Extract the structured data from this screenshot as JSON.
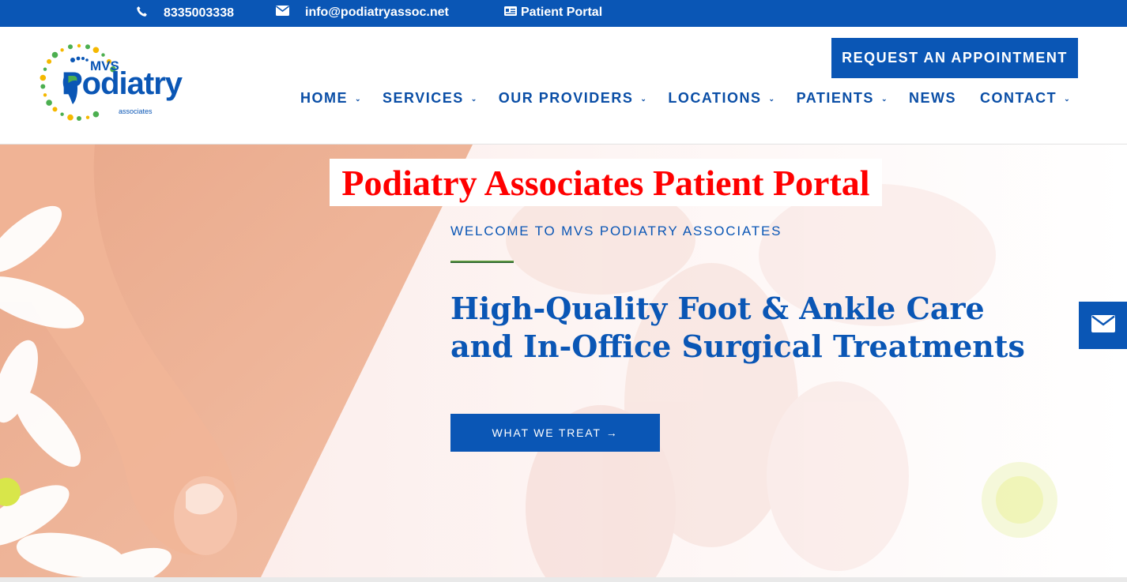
{
  "topbar": {
    "phone": "8335003338",
    "email": "info@podiatryassoc.net",
    "portal": "Patient Portal",
    "icons": [
      "phone-icon",
      "envelope-icon",
      "id-card-icon"
    ]
  },
  "logo": {
    "mvs": "MVS",
    "wordmark": "Podiatry",
    "sub": "associates"
  },
  "header": {
    "request_button": "REQUEST AN APPOINTMENT",
    "nav": [
      {
        "label": "HOME",
        "dropdown": true
      },
      {
        "label": "SERVICES",
        "dropdown": true
      },
      {
        "label": "OUR PROVIDERS",
        "dropdown": true
      },
      {
        "label": "LOCATIONS",
        "dropdown": true
      },
      {
        "label": "PATIENTS",
        "dropdown": true
      },
      {
        "label": "NEWS",
        "dropdown": false
      },
      {
        "label": "CONTACT",
        "dropdown": true
      }
    ]
  },
  "hero": {
    "portal_title": "Podiatry Associates Patient Portal",
    "welcome": "WELCOME TO MVS PODIATRY ASSOCIATES",
    "headline_line1": "High-Quality Foot & Ankle Care",
    "headline_line2": "and In-Office Surgical Treatments",
    "cta": "WHAT WE TREAT",
    "cta_arrow": "→"
  },
  "colors": {
    "brand_blue": "#0a56b5",
    "portal_red": "#ff0000",
    "accent_green": "#7ab648"
  }
}
